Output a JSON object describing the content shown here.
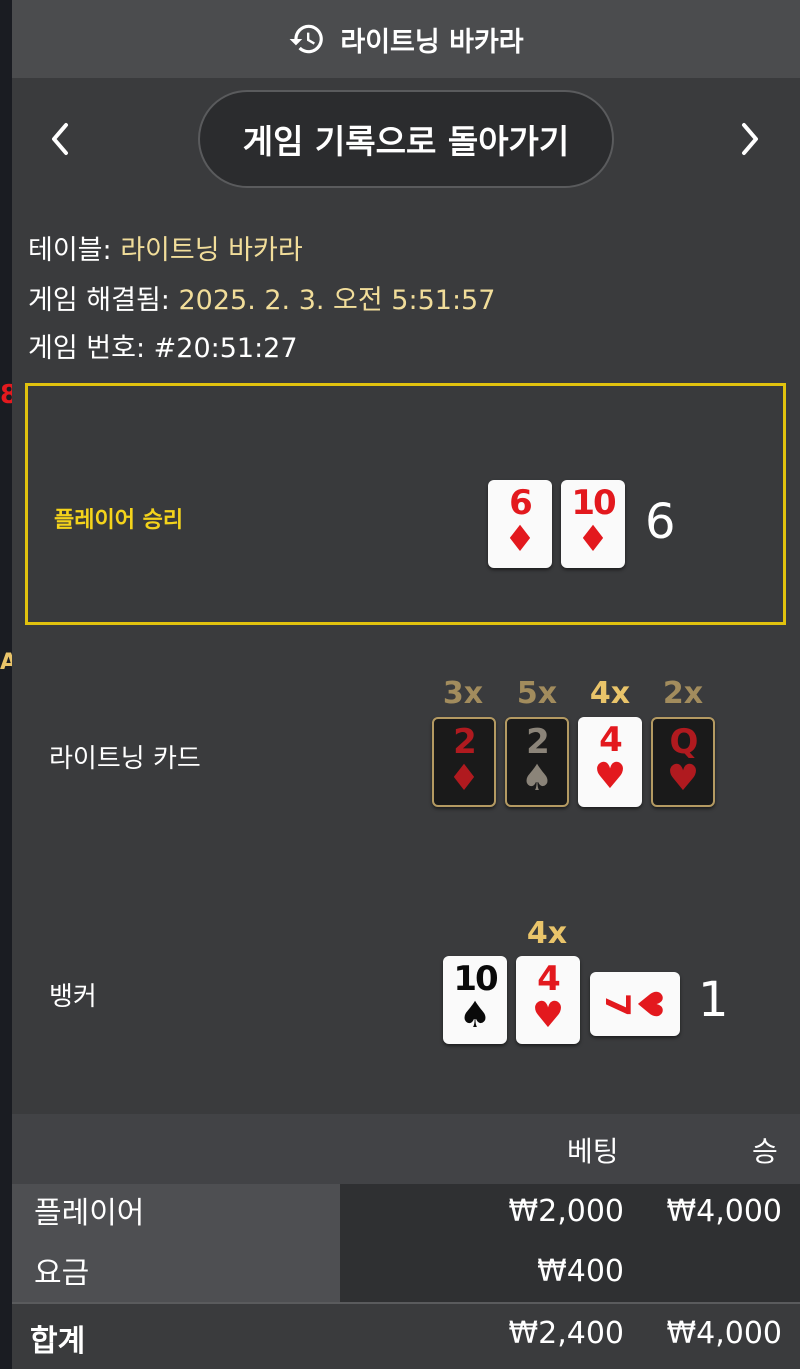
{
  "header": {
    "title": "라이트닝 바카라",
    "history_icon": "history-icon"
  },
  "nav": {
    "back_label": "게임 기록으로 돌아가기",
    "prev_icon": "chevron-left-icon",
    "next_icon": "chevron-right-icon"
  },
  "info": {
    "table_label": "테이블:",
    "table_value": "라이트닝 바카라",
    "resolved_label": "게임 해결됨:",
    "resolved_value": "2025. 2. 3. 오전 5:51:57",
    "game_no_label": "게임 번호:",
    "game_no_value": "#20:51:27"
  },
  "player": {
    "result_label": "플레이어 승리",
    "cards": [
      {
        "rank": "6",
        "suit": "♦"
      },
      {
        "rank": "10",
        "suit": "♦"
      }
    ],
    "score": "6"
  },
  "lightning": {
    "label": "라이트닝 카드",
    "cards": [
      {
        "mult": "3x",
        "rank": "2",
        "suit": "♦"
      },
      {
        "mult": "5x",
        "rank": "2",
        "suit": "♠"
      },
      {
        "mult": "4x",
        "rank": "4",
        "suit": "♥"
      },
      {
        "mult": "2x",
        "rank": "Q",
        "suit": "♥"
      }
    ]
  },
  "banker": {
    "label": "뱅커",
    "mult": "4x",
    "cards": [
      {
        "rank": "10",
        "suit": "♠"
      },
      {
        "rank": "4",
        "suit": "♥"
      },
      {
        "rank": "7",
        "suit": "♥"
      }
    ],
    "score": "1"
  },
  "summary": {
    "col_bet": "베팅",
    "col_win": "승",
    "rows": [
      {
        "label": "플레이어",
        "bet": "₩2,000",
        "win": "₩4,000"
      },
      {
        "label": "요금",
        "bet": "₩400",
        "win": ""
      }
    ],
    "total": {
      "label": "합계",
      "bet": "₩2,400",
      "win": "₩4,000"
    }
  }
}
